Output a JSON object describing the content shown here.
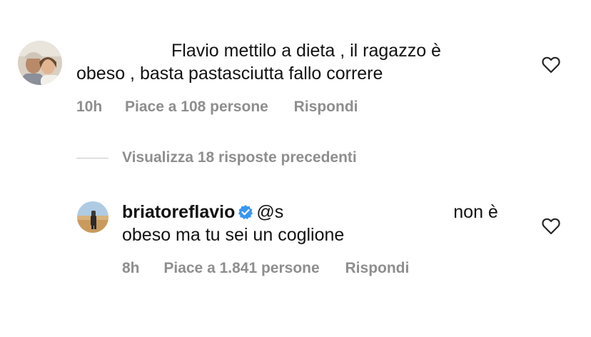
{
  "comment1": {
    "line1": "Flavio mettilo a dieta , il ragazzo è",
    "line2": "obeso , basta pastasciutta fallo correre",
    "time": "10h",
    "likes": "Piace a 108 persone",
    "reply": "Rispondi",
    "like_icon": "heart-outline-icon"
  },
  "replies_toggle": {
    "label": "Visualizza 18 risposte precedenti"
  },
  "comment2": {
    "username": "briatoreflavio",
    "verified_icon": "verified-badge-icon",
    "mention": "@s",
    "line1_tail": "non è",
    "line2": "obeso ma tu sei un coglione",
    "time": "8h",
    "likes": "Piace a 1.841 persone",
    "reply": "Rispondi",
    "like_icon": "heart-outline-icon"
  },
  "colors": {
    "text": "#121212",
    "secondary": "#8e8e8e",
    "verified": "#3897f0"
  }
}
